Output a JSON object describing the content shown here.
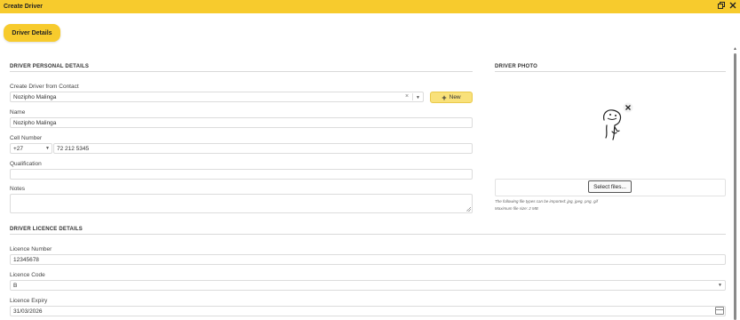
{
  "window": {
    "title": "Create Driver",
    "restore_icon": "restore-icon",
    "close_icon": "close-icon"
  },
  "tabs": {
    "driver_details": "Driver Details"
  },
  "personal": {
    "heading": "DRIVER PERSONAL DETAILS",
    "contact_label": "Create Driver from Contact",
    "contact_value": "Nozipho Malinga",
    "new_label": "New",
    "name_label": "Name",
    "name_value": "Nozipho Malinga",
    "cell_label": "Cell Number",
    "cell_code": "+27",
    "cell_value": "72 212 5345",
    "qualification_label": "Qualification",
    "qualification_value": "",
    "notes_label": "Notes",
    "notes_value": ""
  },
  "photo": {
    "heading": "DRIVER PHOTO",
    "select_files": "Select files...",
    "hint_types": "The following file types can be imported: jpg, jpeg, png, gif",
    "hint_size": "Maximum file size: 2 MB"
  },
  "licence": {
    "heading": "DRIVER LICENCE DETAILS",
    "number_label": "Licence Number",
    "number_value": "12345678",
    "code_label": "Licence Code",
    "code_value": "B",
    "expiry_label": "Licence Expiry",
    "expiry_value": "31/03/2026"
  },
  "icons": {
    "clear": "×",
    "dropdown": "▼",
    "remove_photo": "✕"
  },
  "colors": {
    "accent": "#f7cb2d",
    "new_button": "#f9e17a"
  }
}
